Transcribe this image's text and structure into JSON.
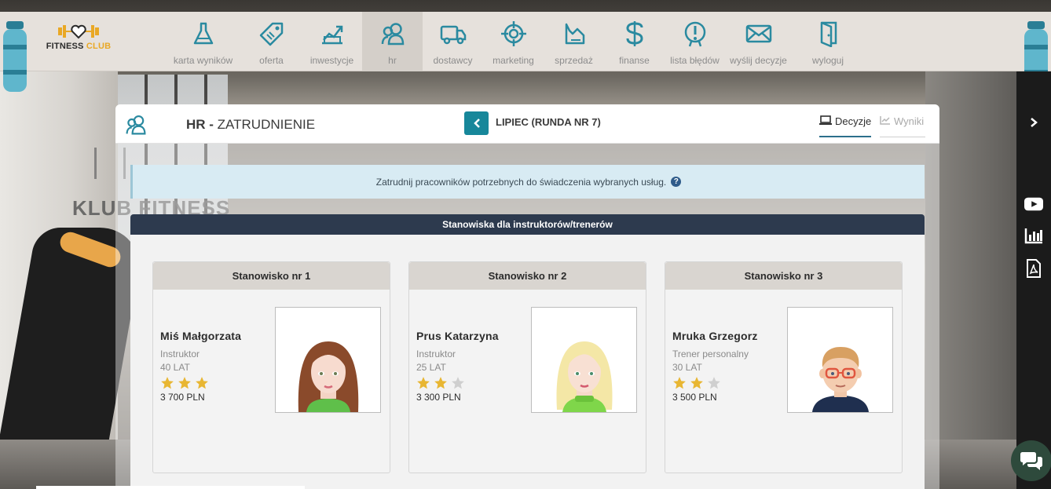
{
  "brand": {
    "name_part1": "FITNESS",
    "name_part2": "CLUB",
    "background_sign": "KLUB FITNESS"
  },
  "nav": [
    {
      "label": "karta wyników",
      "icon": "flask-icon"
    },
    {
      "label": "oferta",
      "icon": "tag-icon"
    },
    {
      "label": "inwestycje",
      "icon": "investment-icon"
    },
    {
      "label": "hr",
      "icon": "people-icon",
      "active": true
    },
    {
      "label": "dostawcy",
      "icon": "truck-icon"
    },
    {
      "label": "marketing",
      "icon": "target-icon"
    },
    {
      "label": "sprzedaż",
      "icon": "sales-icon"
    },
    {
      "label": "finanse",
      "icon": "dollar-icon"
    },
    {
      "label": "lista błędów",
      "icon": "error-icon"
    },
    {
      "label": "wyślij decyzje",
      "icon": "envelope-icon"
    },
    {
      "label": "wyloguj",
      "icon": "logout-icon"
    }
  ],
  "header": {
    "title_bold": "HR -",
    "title_rest": " ZATRUDNIENIE",
    "round": "LIPIEC (RUNDA NR 7)",
    "tab_decisions": "Decyzje",
    "tab_results": "Wyniki"
  },
  "info": {
    "text": "Zatrudnij pracowników potrzebnych do świadczenia wybranych usług.",
    "help": "?"
  },
  "section": {
    "title": "Stanowiska dla instruktorów/trenerów"
  },
  "positions": [
    {
      "title": "Stanowisko nr 1",
      "name": "Miś Małgorzata",
      "role": "Instruktor",
      "age": "40 LAT",
      "stars": 3,
      "salary": "3 700 PLN",
      "avatar": "woman-brown-hair-avatar"
    },
    {
      "title": "Stanowisko nr 2",
      "name": "Prus Katarzyna",
      "role": "Instruktor",
      "age": "25 LAT",
      "stars": 2,
      "salary": "3 300 PLN",
      "avatar": "woman-blonde-hair-avatar"
    },
    {
      "title": "Stanowisko nr 3",
      "name": "Mruka Grzegorz",
      "role": "Trener personalny",
      "age": "30 LAT",
      "stars": 2,
      "salary": "3 500 PLN",
      "avatar": "man-glasses-avatar"
    }
  ],
  "max_stars": 3,
  "colors": {
    "accent": "#17879a",
    "nav_icon": "#2a8aa0",
    "section_bar": "#2d3a4e",
    "star_on": "#e8b632",
    "star_off": "#cfcfcf"
  }
}
